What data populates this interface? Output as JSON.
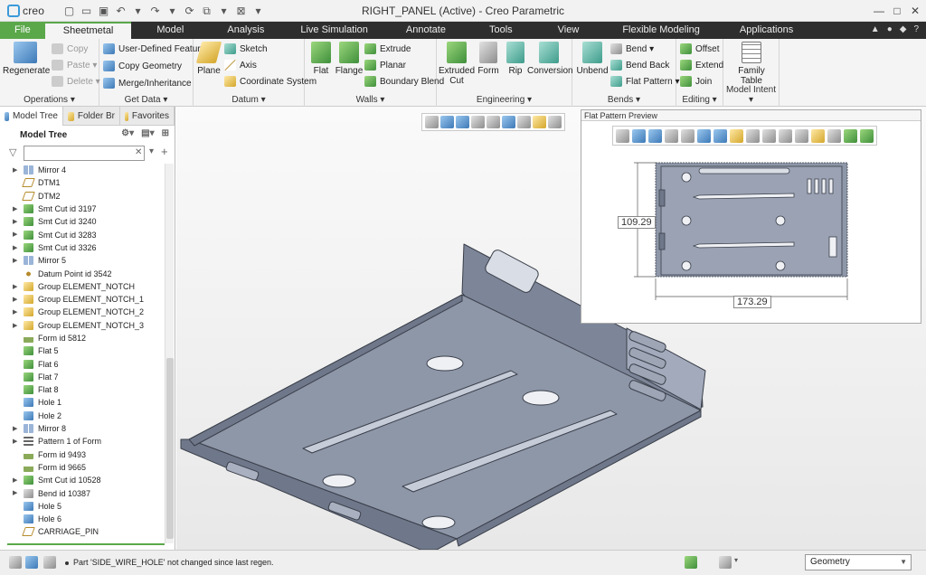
{
  "app": {
    "logo_text": "creo",
    "window_title": "RIGHT_PANEL (Active) - Creo Parametric"
  },
  "ribbon_tabs": [
    "File",
    "Sheetmetal",
    "Model",
    "Analysis",
    "Live Simulation",
    "Annotate",
    "Tools",
    "View",
    "Flexible Modeling",
    "Applications"
  ],
  "groups": {
    "operations": {
      "label": "Operations ▾",
      "regenerate": "Regenerate",
      "copy": "Copy",
      "paste": "Paste ▾",
      "delete": "Delete ▾"
    },
    "get_data": {
      "label": "Get Data ▾",
      "user_defined_feature": "User-Defined Feature",
      "copy_geometry": "Copy Geometry",
      "merge_inheritance": "Merge/Inheritance"
    },
    "datum": {
      "label": "Datum ▾",
      "plane": "Plane",
      "sketch": "Sketch",
      "axis": "Axis",
      "coordinate_system": "Coordinate System"
    },
    "walls": {
      "label": "Walls ▾",
      "flat": "Flat",
      "flange": "Flange",
      "extrude": "Extrude",
      "planar": "Planar",
      "boundary_blend": "Boundary Blend"
    },
    "engineering": {
      "label": "Engineering ▾",
      "extruded_cut": "Extruded Cut",
      "form": "Form",
      "rip": "Rip",
      "conversion": "Conversion"
    },
    "bends": {
      "label": "Bends ▾",
      "unbend": "Unbend",
      "bend": "Bend ▾",
      "bend_back": "Bend Back",
      "flat_pattern": "Flat Pattern ▾"
    },
    "editing": {
      "label": "Editing ▾",
      "offset": "Offset",
      "extend": "Extend",
      "join": "Join"
    },
    "model_intent": {
      "label": "Model Intent ▾",
      "family_table": "Family Table"
    }
  },
  "panel_tabs": [
    "Model Tree",
    "Folder Br",
    "Favorites"
  ],
  "model_tree": {
    "header": "Model Tree",
    "items": [
      {
        "label": "Mirror 4",
        "icon": "mirror-icon",
        "expandable": true
      },
      {
        "label": "DTM1",
        "icon": "datum-plane-icon",
        "expandable": false
      },
      {
        "label": "DTM2",
        "icon": "datum-plane-icon",
        "expandable": false
      },
      {
        "label": "Smt Cut id 3197",
        "icon": "cut-icon",
        "expandable": true
      },
      {
        "label": "Smt Cut id 3240",
        "icon": "cut-icon",
        "expandable": true
      },
      {
        "label": "Smt Cut id 3283",
        "icon": "cut-icon",
        "expandable": true
      },
      {
        "label": "Smt Cut id 3326",
        "icon": "cut-icon",
        "expandable": true
      },
      {
        "label": "Mirror 5",
        "icon": "mirror-icon",
        "expandable": true
      },
      {
        "label": "Datum Point id 3542",
        "icon": "datum-point-icon",
        "expandable": false
      },
      {
        "label": "Group ELEMENT_NOTCH",
        "icon": "group-icon",
        "expandable": true
      },
      {
        "label": "Group ELEMENT_NOTCH_1",
        "icon": "group-icon",
        "expandable": true
      },
      {
        "label": "Group ELEMENT_NOTCH_2",
        "icon": "group-icon",
        "expandable": true
      },
      {
        "label": "Group ELEMENT_NOTCH_3",
        "icon": "group-icon",
        "expandable": true
      },
      {
        "label": "Form id 5812",
        "icon": "form-icon",
        "expandable": false
      },
      {
        "label": "Flat 5",
        "icon": "flat-icon",
        "expandable": false
      },
      {
        "label": "Flat 6",
        "icon": "flat-icon",
        "expandable": false
      },
      {
        "label": "Flat 7",
        "icon": "flat-icon",
        "expandable": false
      },
      {
        "label": "Flat 8",
        "icon": "flat-icon",
        "expandable": false
      },
      {
        "label": "Hole 1",
        "icon": "hole-icon",
        "expandable": false
      },
      {
        "label": "Hole 2",
        "icon": "hole-icon",
        "expandable": false
      },
      {
        "label": "Mirror 8",
        "icon": "mirror-icon",
        "expandable": true
      },
      {
        "label": "Pattern 1 of Form",
        "icon": "pattern-icon",
        "expandable": true
      },
      {
        "label": "Form id 9493",
        "icon": "form-icon",
        "expandable": false
      },
      {
        "label": "Form id 9665",
        "icon": "form-icon",
        "expandable": false
      },
      {
        "label": "Smt Cut id 10528",
        "icon": "cut-icon",
        "expandable": true
      },
      {
        "label": "Bend id 10387",
        "icon": "bend-icon",
        "expandable": true
      },
      {
        "label": "Hole 5",
        "icon": "hole-icon",
        "expandable": false
      },
      {
        "label": "Hole 6",
        "icon": "hole-icon",
        "expandable": false
      },
      {
        "label": "CARRIAGE_PIN",
        "icon": "datum-plane-icon",
        "expandable": false
      }
    ]
  },
  "flat_pattern_preview": {
    "title": "Flat Pattern Preview",
    "dim_height": "109.29",
    "dim_width": "173.29"
  },
  "status": {
    "message": "Part 'SIDE_WIRE_HOLE' not changed since last regen.",
    "selection_filter": "Geometry"
  },
  "colors": {
    "file_tab": "#5aa84a",
    "tab_bar": "#2e2e2e",
    "part_fill": "#8e97a8",
    "part_edge": "#3a3f4a"
  }
}
